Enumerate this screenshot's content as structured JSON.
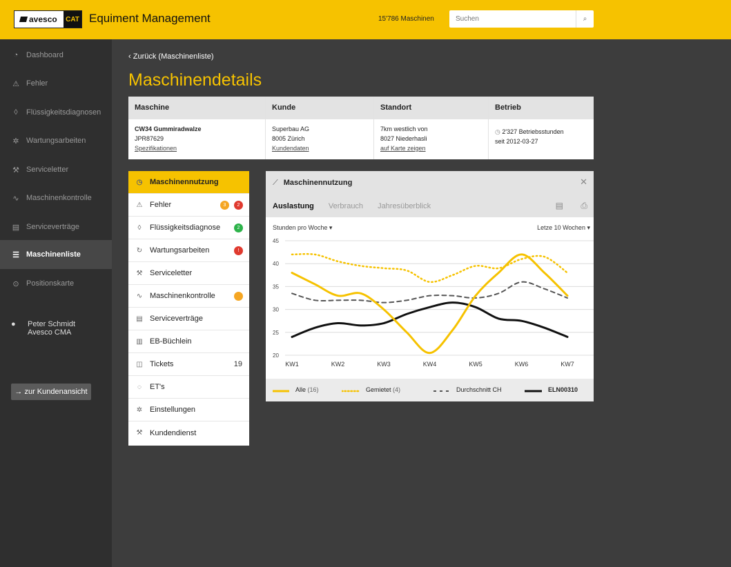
{
  "header": {
    "brand": "avesco",
    "brand_cat": "CAT",
    "app_title": "Equiment Management",
    "machine_count": "15'786 Maschinen",
    "search_placeholder": "Suchen"
  },
  "sidebar": {
    "items": [
      {
        "label": "Dashboard",
        "icon": "dashboard-icon"
      },
      {
        "label": "Fehler",
        "icon": "warning-icon"
      },
      {
        "label": "Flüssigkeitsdiagnosen",
        "icon": "drop-icon"
      },
      {
        "label": "Wartungsarbeiten",
        "icon": "gear-icon"
      },
      {
        "label": "Serviceletter",
        "icon": "wrench-icon"
      },
      {
        "label": "Maschinenkontrolle",
        "icon": "pulse-icon"
      },
      {
        "label": "Serviceverträge",
        "icon": "document-icon"
      },
      {
        "label": "Maschinenliste",
        "icon": "list-icon",
        "active": true
      },
      {
        "label": "Positionskarte",
        "icon": "location-pin-icon"
      }
    ],
    "user_name": "Peter Schmidt",
    "user_company": "Avesco CMA",
    "customer_view_button": "→ zur Kundenansicht"
  },
  "page": {
    "back_link": "Zurück (Maschinenliste)",
    "title": "Maschinendetails"
  },
  "details": {
    "headers": [
      "Maschine",
      "Kunde",
      "Standort",
      "Betrieb"
    ],
    "machine_name": "CW34 Gummiradwalze",
    "machine_id": "JPR87629",
    "machine_link": "Spezifikationen",
    "customer_name": "Superbau AG",
    "customer_city": "8005 Zürich",
    "customer_link": "Kundendaten",
    "location_line1": "7km westlich von",
    "location_line2": "8027 Niederhasli",
    "location_link": "auf Karte zeigen",
    "operation_hours": "2'327 Betriebsstunden",
    "operation_since": "seit 2012-03-27"
  },
  "submenu": {
    "items": [
      {
        "label": "Maschinennutzung",
        "icon": "clock-icon",
        "active": true
      },
      {
        "label": "Fehler",
        "icon": "warning-icon",
        "badges": [
          "3",
          "2"
        ]
      },
      {
        "label": "Flüssigkeitsdiagnose",
        "icon": "drop-icon",
        "badges": [
          "2"
        ]
      },
      {
        "label": "Wartungsarbeiten",
        "icon": "refresh-icon",
        "badges": [
          "!"
        ]
      },
      {
        "label": "Serviceletter",
        "icon": "wrench-icon"
      },
      {
        "label": "Maschinenkontrolle",
        "icon": "pulse-icon",
        "badges": [
          ""
        ]
      },
      {
        "label": "Serviceverträge",
        "icon": "document-icon"
      },
      {
        "label": "EB-Büchlein",
        "icon": "book-icon"
      },
      {
        "label": "Tickets",
        "icon": "ticket-icon",
        "count": "19"
      },
      {
        "label": "ET's",
        "icon": "parts-icon"
      },
      {
        "label": "Einstellungen",
        "icon": "settings-icon"
      },
      {
        "label": "Kundendienst",
        "icon": "service-icon"
      }
    ],
    "badge_colors": {
      "orange": "#f5a623",
      "red": "#e03a2f",
      "green": "#2db34a"
    }
  },
  "panel": {
    "title": "Maschinennutzung",
    "tabs": [
      "Auslastung",
      "Verbrauch",
      "Jahresüberblick"
    ],
    "unit_select": "Stunden pro Woche",
    "range_select": "Letze 10 Wochen"
  },
  "legend": {
    "all": "Alle",
    "all_count": "(16)",
    "rented": "Gemietet",
    "rented_count": "(4)",
    "avg": "Durchschnitt CH",
    "machine": "ELN00310"
  },
  "chart_data": {
    "type": "line",
    "x": [
      1,
      1.5,
      2,
      2.5,
      3,
      3.5,
      4,
      4.5,
      5,
      5.5,
      6,
      6.5,
      7
    ],
    "x_ticks": [
      "KW1",
      "KW2",
      "KW3",
      "KW4",
      "KW5",
      "KW6",
      "KW7"
    ],
    "yticks": [
      20,
      25,
      30,
      35,
      40,
      45
    ],
    "ylim": [
      20,
      45
    ],
    "colors": {
      "all": "#f6c200",
      "rented": "#f6c200",
      "avg": "#555555",
      "machine": "#111111"
    },
    "series": [
      {
        "name": "Alle",
        "style": "solid",
        "values": [
          38,
          35.5,
          33,
          33.5,
          30,
          25,
          20.5,
          25.5,
          33,
          38,
          42,
          38,
          33
        ]
      },
      {
        "name": "Gemietet",
        "style": "dotted",
        "values": [
          42,
          42,
          40.5,
          39.5,
          39,
          38.5,
          36,
          37.5,
          39.5,
          39,
          41,
          41.5,
          38
        ]
      },
      {
        "name": "Durchschnitt CH",
        "style": "dashed",
        "values": [
          33.5,
          32,
          32,
          32,
          31.5,
          32,
          33,
          33,
          32.5,
          33.5,
          36,
          34.5,
          32.5
        ]
      },
      {
        "name": "ELN00310",
        "style": "solid",
        "values": [
          24,
          26,
          27,
          26.5,
          27,
          29,
          30.5,
          31.5,
          30.5,
          28,
          27.5,
          26,
          24
        ]
      }
    ]
  }
}
